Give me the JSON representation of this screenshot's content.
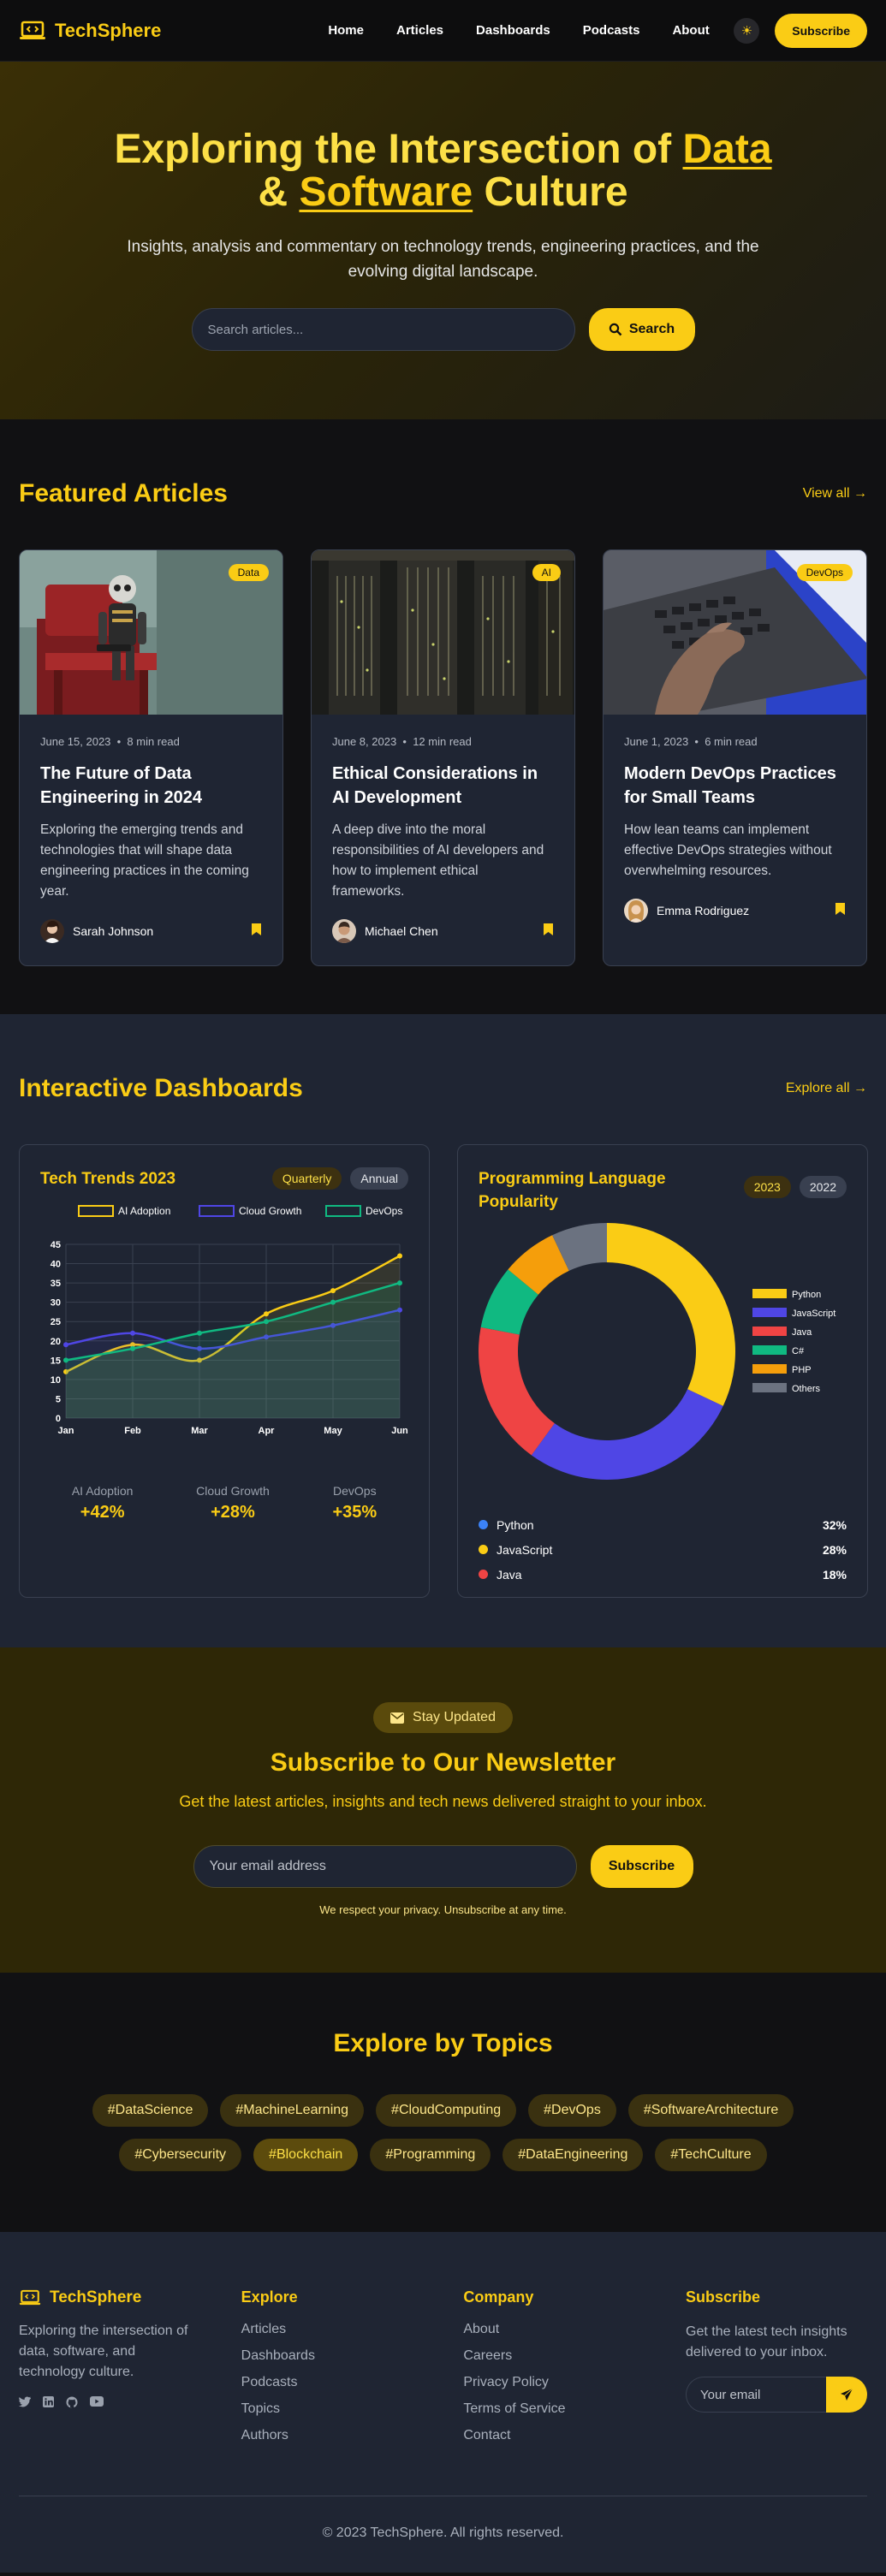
{
  "nav": {
    "brand": "TechSphere",
    "links": [
      "Home",
      "Articles",
      "Dashboards",
      "Podcasts",
      "About"
    ],
    "subscribe_label": "Subscribe"
  },
  "hero": {
    "title_part1": "Exploring the Intersection of ",
    "title_data": "Data",
    "title_amp": "& ",
    "title_software": "Software",
    "title_culture": " Culture",
    "subtitle": "Insights, analysis and commentary on technology trends, engineering practices, and the evolving digital landscape.",
    "search_placeholder": "Search articles...",
    "search_label": "Search"
  },
  "featured": {
    "title": "Featured Articles",
    "view_all": "View all",
    "articles": [
      {
        "tag": "Data",
        "date": "June 15, 2023",
        "read": "8 min read",
        "title": "The Future of Data Engineering in 2024",
        "excerpt": "Exploring the emerging trends and technologies that will shape data engineering practices in the coming year.",
        "author": "Sarah Johnson"
      },
      {
        "tag": "AI",
        "date": "June 8, 2023",
        "read": "12 min read",
        "title": "Ethical Considerations in AI Development",
        "excerpt": "A deep dive into the moral responsibilities of AI developers and how to implement ethical frameworks.",
        "author": "Michael Chen"
      },
      {
        "tag": "DevOps",
        "date": "June 1, 2023",
        "read": "6 min read",
        "title": "Modern DevOps Practices for Small Teams",
        "excerpt": "How lean teams can implement effective DevOps strategies without overwhelming resources.",
        "author": "Emma Rodriguez"
      }
    ]
  },
  "dashboards": {
    "title": "Interactive Dashboards",
    "explore_all": "Explore all",
    "trends": {
      "title": "Tech Trends 2023",
      "pill_active": "Quarterly",
      "pill_other": "Annual",
      "stats": [
        {
          "label": "AI Adoption",
          "value": "+42%"
        },
        {
          "label": "Cloud Growth",
          "value": "+28%"
        },
        {
          "label": "DevOps",
          "value": "+35%"
        }
      ]
    },
    "languages": {
      "title": "Programming Language Popularity",
      "pill_active": "2023",
      "pill_other": "2022",
      "list": [
        {
          "name": "Python",
          "pct": "32%",
          "color": "#3b82f6"
        },
        {
          "name": "JavaScript",
          "pct": "28%",
          "color": "#facc15"
        },
        {
          "name": "Java",
          "pct": "18%",
          "color": "#ef4444"
        }
      ]
    }
  },
  "chart_data": [
    {
      "type": "line",
      "title": "",
      "x": [
        "Jan",
        "Feb",
        "Mar",
        "Apr",
        "May",
        "Jun"
      ],
      "ylim": [
        0,
        45
      ],
      "yticks": [
        0,
        5,
        10,
        15,
        20,
        25,
        30,
        35,
        40,
        45
      ],
      "grid": true,
      "legend": "top",
      "series": [
        {
          "name": "AI Adoption",
          "color": "#facc15",
          "values": [
            12,
            19,
            15,
            27,
            33,
            42
          ]
        },
        {
          "name": "Cloud Growth",
          "color": "#4f46e5",
          "values": [
            19,
            22,
            18,
            21,
            24,
            28
          ]
        },
        {
          "name": "DevOps",
          "color": "#10b981",
          "values": [
            15,
            18,
            22,
            25,
            30,
            35
          ]
        }
      ]
    },
    {
      "type": "pie",
      "title": "",
      "legend": "right",
      "slices": [
        {
          "name": "Python",
          "value": 32,
          "color": "#facc15"
        },
        {
          "name": "JavaScript",
          "value": 28,
          "color": "#4f46e5"
        },
        {
          "name": "Java",
          "value": 18,
          "color": "#ef4444"
        },
        {
          "name": "C#",
          "value": 8,
          "color": "#10b981"
        },
        {
          "name": "PHP",
          "value": 7,
          "color": "#f59e0b"
        },
        {
          "name": "Others",
          "value": 7,
          "color": "#6b7280"
        }
      ]
    }
  ],
  "newsletter": {
    "badge": "Stay Updated",
    "title": "Subscribe to Our Newsletter",
    "subtitle": "Get the latest articles, insights and tech news delivered straight to your inbox.",
    "placeholder": "Your email address",
    "button": "Subscribe",
    "privacy": "We respect your privacy. Unsubscribe at any time."
  },
  "topics": {
    "title": "Explore by Topics",
    "items": [
      "#DataScience",
      "#MachineLearning",
      "#CloudComputing",
      "#DevOps",
      "#SoftwareArchitecture",
      "#Cybersecurity",
      "#Blockchain",
      "#Programming",
      "#DataEngineering",
      "#TechCulture"
    ]
  },
  "footer": {
    "brand": "TechSphere",
    "about": "Exploring the intersection of data, software, and technology culture.",
    "explore_title": "Explore",
    "explore_links": [
      "Articles",
      "Dashboards",
      "Podcasts",
      "Topics",
      "Authors"
    ],
    "company_title": "Company",
    "company_links": [
      "About",
      "Careers",
      "Privacy Policy",
      "Terms of Service",
      "Contact"
    ],
    "subscribe_title": "Subscribe",
    "subscribe_text": "Get the latest tech insights delivered to your inbox.",
    "email_placeholder": "Your email",
    "copyright": "© 2023 TechSphere. All rights reserved."
  }
}
